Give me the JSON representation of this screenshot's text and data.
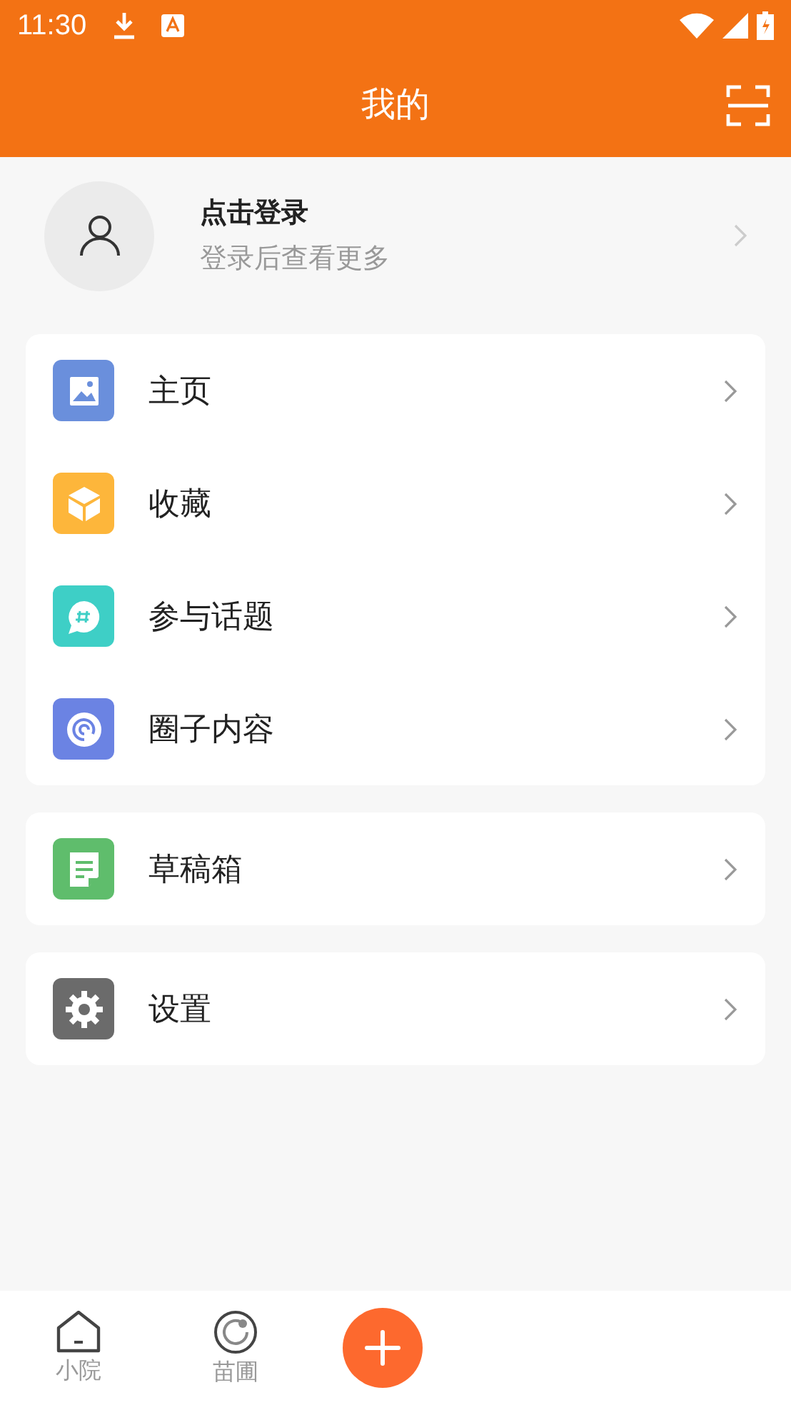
{
  "status_bar": {
    "time": "11:30"
  },
  "header": {
    "title": "我的"
  },
  "profile": {
    "name": "点击登录",
    "subtitle": "登录后查看更多"
  },
  "menu_groups": [
    {
      "items": [
        {
          "kind": "image",
          "label": "主页",
          "color": "#6a8fdc"
        },
        {
          "kind": "cube",
          "label": "收藏",
          "color": "#fdb63b"
        },
        {
          "kind": "topic",
          "label": "参与话题",
          "color": "#3ecfc6"
        },
        {
          "kind": "circle",
          "label": "圈子内容",
          "color": "#6b83e3"
        }
      ]
    },
    {
      "items": [
        {
          "kind": "draft",
          "label": "草稿箱",
          "color": "#5fbd6c"
        }
      ]
    },
    {
      "items": [
        {
          "kind": "gear",
          "label": "设置",
          "color": "#6b6b6b"
        }
      ]
    }
  ],
  "bottom_nav": [
    {
      "kind": "home",
      "label": "小院"
    },
    {
      "kind": "nursery",
      "label": "苗圃"
    },
    {
      "kind": "add"
    }
  ]
}
